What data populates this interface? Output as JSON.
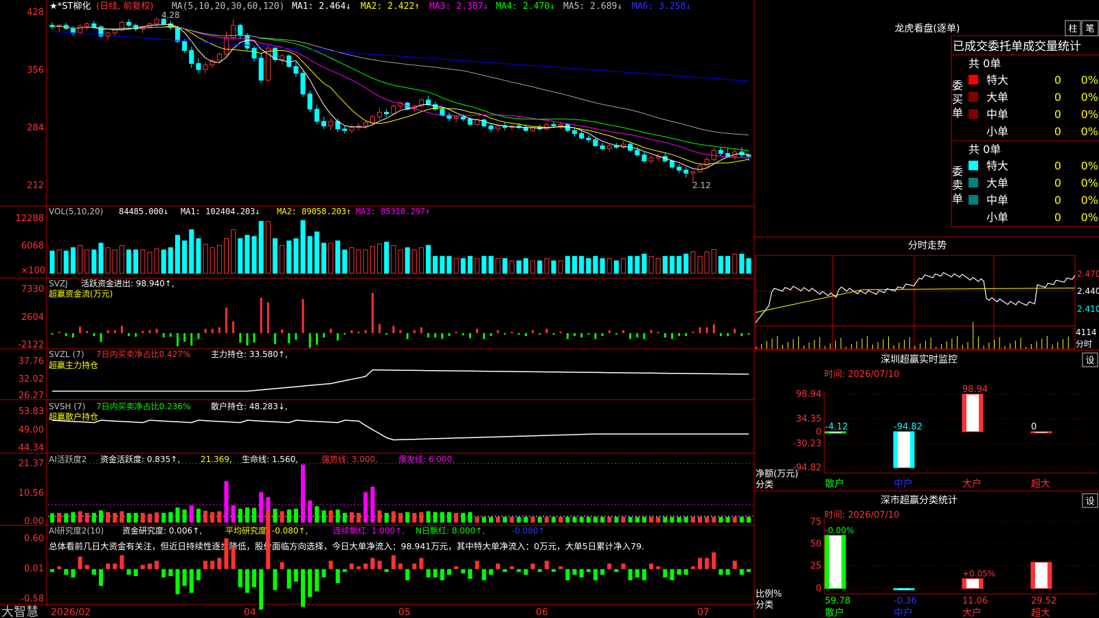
{
  "colors": {
    "up": "#ff3232",
    "down": "#00ffff",
    "grid": "#c00000",
    "ma1": "#ffffff",
    "ma2": "#ffff00",
    "ma3": "#ff00ff",
    "ma4": "#00ff00",
    "ma5": "#a0a0a0",
    "ma6": "#0000ff",
    "text": "#c0c0c0"
  },
  "header": {
    "stock_name": "★*ST柳化",
    "period": "(日线, 前复权)",
    "ma_formula": "MA(5,10,20,30,60,120)",
    "ma_values": [
      "MA1: 2.464↓",
      "MA2: 2.422↑",
      "MA3: 2.387↓",
      "MA4: 2.470↓",
      "MA5: 2.689↓",
      "MA6: 3.258↓"
    ]
  },
  "price_panel": {
    "y_ticks": [
      "428",
      "356",
      "284",
      "212"
    ],
    "high_label": "4.28",
    "low_label": "2.12",
    "y_range": [
      1.9,
      4.35
    ]
  },
  "volume_panel": {
    "title": "VOL(5,10,20)",
    "value": "84485.000↓",
    "ma_values": [
      "MA1: 102404.203↓",
      "MA2: 89058.203↑",
      "MA3: 85318.297↑"
    ],
    "y_ticks": [
      "12288",
      "6068",
      "×100"
    ],
    "y_range": [
      0,
      130000
    ]
  },
  "svzj_panel": {
    "title": "SVZJ",
    "label": "活跃资金进出: 98.940↑,",
    "subtitle": "超赢资金流(万元)",
    "y_ticks": [
      "7330",
      "2604",
      "-2122"
    ],
    "y_range": [
      -2122,
      7330
    ]
  },
  "svzl_panel": {
    "title": "SVZL (7)",
    "label1": "7日内买卖净占比0.427%",
    "label2": "主力持仓: 33.580↑,",
    "subtitle": "超赢主力持仓",
    "y_ticks": [
      "37.76",
      "32.02",
      "26.27"
    ],
    "y_range": [
      26.27,
      37.76
    ]
  },
  "svsh_panel": {
    "title": "SVSH (7)",
    "label1": "7日内买卖净占比0.236%",
    "label2": "散户持仓: 48.283↓,",
    "subtitle": "超赢散户持仓",
    "y_ticks": [
      "53.83",
      "49.00",
      "44.34"
    ],
    "y_range": [
      44.34,
      53.83
    ]
  },
  "ai_active_panel": {
    "title": "AI活跃度2",
    "label1": "资金活跃度: 0.835↑,",
    "label2": "21.369,",
    "label3": "生命线: 1.560,",
    "label4": "强势线: 3.000,",
    "label5": "爆发线: 6.000,",
    "y_ticks": [
      "21.37",
      "10.56",
      "0.00"
    ],
    "y_range": [
      0,
      21.37
    ]
  },
  "ai_research_panel": {
    "title": "AI研究度2(10)",
    "label1": "资金研究度: 0.006↑,",
    "label2": "平均研究度: -0.080↑,",
    "label3": "连续飘红: 1.000↑,",
    "label4": "N日飘红: 8.000↑,",
    "label5": "-0.080↑",
    "comment": "总体看前几日大资金有关注，但近日持续性逐步降低，股价面临方向选择，今日大单净流入：98.941万元，其中特大单净流入：0万元，大单5日累计净入79.",
    "y_ticks": [
      "0.60",
      "0.01",
      "-0.58"
    ],
    "y_range": [
      -0.58,
      0.6
    ]
  },
  "x_axis": {
    "labels": [
      "2026/02",
      "04",
      "05",
      "06",
      "07"
    ]
  },
  "brand": "大智慧",
  "right": {
    "lhb": {
      "title": "龙虎看盘(逐单)",
      "btn_col": "柱",
      "btn_pen": "笔",
      "tabs": "已成交委托单成交量统计",
      "buy_group": {
        "side": "委买单",
        "total": "共 0单",
        "rows": [
          {
            "label": "特大",
            "count": "0",
            "pct": "0%",
            "color": "#ff0000"
          },
          {
            "label": "大单",
            "count": "0",
            "pct": "0%",
            "color": "#800000"
          },
          {
            "label": "中单",
            "count": "0",
            "pct": "0%",
            "color": "#800000"
          },
          {
            "label": "小单",
            "count": "0",
            "pct": "0%",
            "color": ""
          }
        ]
      },
      "sell_group": {
        "side": "委卖单",
        "total": "共 0单",
        "rows": [
          {
            "label": "特大",
            "count": "0",
            "pct": "0%",
            "color": "#00ffff"
          },
          {
            "label": "大单",
            "count": "0",
            "pct": "0%",
            "color": "#008080"
          },
          {
            "label": "中单",
            "count": "0",
            "pct": "0%",
            "color": "#008080"
          },
          {
            "label": "小单",
            "count": "0",
            "pct": "0%",
            "color": ""
          }
        ]
      }
    },
    "intraday": {
      "title": "分时走势",
      "y_labels": [
        "2.470",
        "2.440",
        "2.410"
      ],
      "vol_label": "4114",
      "vol_unit": "分时"
    },
    "monitor": {
      "title": "深圳超赢实时监控",
      "btn": "设",
      "time": "时间: 2026/07/10",
      "ylabel": "净额(万元)",
      "xlabel": "分类",
      "y_ticks": [
        "98.94",
        "34.35",
        "0",
        "-30.23",
        "-94.82"
      ],
      "chart_data": {
        "type": "bar",
        "categories": [
          "散户",
          "中户",
          "大户",
          "超大"
        ],
        "values": [
          -4.12,
          -94.82,
          98.94,
          0
        ],
        "value_labels": [
          "-4.12",
          "-94.82",
          "98.94",
          "0"
        ],
        "ylim": [
          -94.82,
          98.94
        ],
        "xlabel": "分类",
        "ylabel": "净额(万元)"
      }
    },
    "classify": {
      "title": "深市超赢分类统计",
      "btn": "设",
      "time": "时间: 2026/07/10",
      "ylabel": "比例%",
      "xlabel": "分类",
      "y_ticks": [
        "75",
        "50",
        "25",
        "0"
      ],
      "chart_data": {
        "type": "bar",
        "categories": [
          "散户",
          "中户",
          "大户",
          "超大"
        ],
        "values": [
          59.78,
          -0.36,
          11.06,
          29.52
        ],
        "value_labels": [
          "59.78",
          "-0.36",
          "11.06",
          "29.52"
        ],
        "change_labels": [
          "-0.00%",
          "",
          "+0.05%",
          ""
        ],
        "ylim": [
          0,
          75
        ],
        "xlabel": "分类",
        "ylabel": "比例%"
      }
    }
  },
  "chart_data": {
    "type": "candlestick",
    "x_labels": [
      "2026/02",
      "04",
      "05",
      "06",
      "07"
    ],
    "candles": [
      [
        4.18,
        4.22,
        4.13,
        4.16
      ],
      [
        4.16,
        4.2,
        4.1,
        4.18
      ],
      [
        4.18,
        4.21,
        4.12,
        4.14
      ],
      [
        4.14,
        4.17,
        4.05,
        4.08
      ],
      [
        4.08,
        4.2,
        4.06,
        4.17
      ],
      [
        4.17,
        4.22,
        4.12,
        4.2
      ],
      [
        4.2,
        4.24,
        4.14,
        4.16
      ],
      [
        4.16,
        4.18,
        4.02,
        4.04
      ],
      [
        4.04,
        4.1,
        3.98,
        4.08
      ],
      [
        4.08,
        4.14,
        4.04,
        4.12
      ],
      [
        4.12,
        4.24,
        4.1,
        4.22
      ],
      [
        4.22,
        4.26,
        4.16,
        4.18
      ],
      [
        4.18,
        4.2,
        4.1,
        4.13
      ],
      [
        4.13,
        4.18,
        4.08,
        4.16
      ],
      [
        4.16,
        4.22,
        4.14,
        4.2
      ],
      [
        4.2,
        4.28,
        4.17,
        4.26
      ],
      [
        4.26,
        4.28,
        4.18,
        4.2
      ],
      [
        4.2,
        4.24,
        4.12,
        4.15
      ],
      [
        4.15,
        4.18,
        3.95,
        3.97
      ],
      [
        3.97,
        4.0,
        3.82,
        3.85
      ],
      [
        3.85,
        3.9,
        3.62,
        3.68
      ],
      [
        3.68,
        3.75,
        3.55,
        3.6
      ],
      [
        3.6,
        3.7,
        3.55,
        3.66
      ],
      [
        3.66,
        3.74,
        3.62,
        3.72
      ],
      [
        3.72,
        3.82,
        3.68,
        3.8
      ],
      [
        3.8,
        4.1,
        3.78,
        4.02
      ],
      [
        4.02,
        4.26,
        3.98,
        4.18
      ],
      [
        4.18,
        4.2,
        4.0,
        4.05
      ],
      [
        4.05,
        4.08,
        3.85,
        3.88
      ],
      [
        3.88,
        3.92,
        3.7,
        3.75
      ],
      [
        3.75,
        3.82,
        3.42,
        3.46
      ],
      [
        3.46,
        3.92,
        3.44,
        3.88
      ],
      [
        3.88,
        3.9,
        3.7,
        3.73
      ],
      [
        3.73,
        3.8,
        3.66,
        3.78
      ],
      [
        3.78,
        3.8,
        3.62,
        3.64
      ],
      [
        3.64,
        3.7,
        3.5,
        3.55
      ],
      [
        3.55,
        3.58,
        3.24,
        3.28
      ],
      [
        3.28,
        3.32,
        3.04,
        3.08
      ],
      [
        3.08,
        3.14,
        2.88,
        2.92
      ],
      [
        2.92,
        2.98,
        2.82,
        2.86
      ],
      [
        2.86,
        2.96,
        2.8,
        2.92
      ],
      [
        2.92,
        2.96,
        2.78,
        2.82
      ],
      [
        2.82,
        2.86,
        2.76,
        2.8
      ],
      [
        2.8,
        2.88,
        2.76,
        2.84
      ],
      [
        2.84,
        2.9,
        2.8,
        2.86
      ],
      [
        2.86,
        2.92,
        2.82,
        2.9
      ],
      [
        2.9,
        3.0,
        2.86,
        2.98
      ],
      [
        2.98,
        3.1,
        2.94,
        3.04
      ],
      [
        3.04,
        3.08,
        2.98,
        3.02
      ],
      [
        3.02,
        3.14,
        3.0,
        3.12
      ],
      [
        3.12,
        3.18,
        3.08,
        3.16
      ],
      [
        3.16,
        3.18,
        3.06,
        3.08
      ],
      [
        3.08,
        3.14,
        3.04,
        3.12
      ],
      [
        3.12,
        3.22,
        3.1,
        3.2
      ],
      [
        3.2,
        3.26,
        3.12,
        3.14
      ],
      [
        3.14,
        3.18,
        3.06,
        3.08
      ],
      [
        3.08,
        3.1,
        2.98,
        3.0
      ],
      [
        3.0,
        3.04,
        2.92,
        2.96
      ],
      [
        2.96,
        3.0,
        2.9,
        2.98
      ],
      [
        2.98,
        3.02,
        2.92,
        2.95
      ],
      [
        2.95,
        2.98,
        2.86,
        2.88
      ],
      [
        2.88,
        2.96,
        2.86,
        2.94
      ],
      [
        2.94,
        2.96,
        2.84,
        2.86
      ],
      [
        2.86,
        2.9,
        2.78,
        2.82
      ],
      [
        2.82,
        2.88,
        2.78,
        2.86
      ],
      [
        2.86,
        2.9,
        2.8,
        2.84
      ],
      [
        2.84,
        2.88,
        2.8,
        2.86
      ],
      [
        2.86,
        2.9,
        2.82,
        2.84
      ],
      [
        2.84,
        2.88,
        2.78,
        2.8
      ],
      [
        2.8,
        2.86,
        2.78,
        2.84
      ],
      [
        2.84,
        2.88,
        2.8,
        2.82
      ],
      [
        2.82,
        2.9,
        2.8,
        2.88
      ],
      [
        2.88,
        2.92,
        2.84,
        2.86
      ],
      [
        2.86,
        2.9,
        2.82,
        2.88
      ],
      [
        2.88,
        2.9,
        2.78,
        2.8
      ],
      [
        2.8,
        2.84,
        2.72,
        2.76
      ],
      [
        2.76,
        2.8,
        2.68,
        2.7
      ],
      [
        2.7,
        2.74,
        2.64,
        2.68
      ],
      [
        2.68,
        2.7,
        2.58,
        2.6
      ],
      [
        2.6,
        2.64,
        2.54,
        2.56
      ],
      [
        2.56,
        2.62,
        2.52,
        2.6
      ],
      [
        2.6,
        2.64,
        2.56,
        2.58
      ],
      [
        2.58,
        2.66,
        2.56,
        2.62
      ],
      [
        2.62,
        2.64,
        2.52,
        2.54
      ],
      [
        2.54,
        2.58,
        2.46,
        2.48
      ],
      [
        2.48,
        2.52,
        2.38,
        2.4
      ],
      [
        2.4,
        2.48,
        2.36,
        2.44
      ],
      [
        2.44,
        2.5,
        2.4,
        2.46
      ],
      [
        2.46,
        2.5,
        2.38,
        2.4
      ],
      [
        2.4,
        2.42,
        2.3,
        2.32
      ],
      [
        2.32,
        2.36,
        2.24,
        2.28
      ],
      [
        2.28,
        2.32,
        2.18,
        2.24
      ],
      [
        2.24,
        2.28,
        2.12,
        2.26
      ],
      [
        2.26,
        2.36,
        2.24,
        2.34
      ],
      [
        2.34,
        2.46,
        2.3,
        2.42
      ],
      [
        2.42,
        2.58,
        2.4,
        2.54
      ],
      [
        2.54,
        2.58,
        2.46,
        2.5
      ],
      [
        2.5,
        2.56,
        2.44,
        2.46
      ],
      [
        2.46,
        2.56,
        2.42,
        2.52
      ],
      [
        2.52,
        2.58,
        2.44,
        2.48
      ],
      [
        2.48,
        2.5,
        2.4,
        2.46
      ]
    ]
  }
}
